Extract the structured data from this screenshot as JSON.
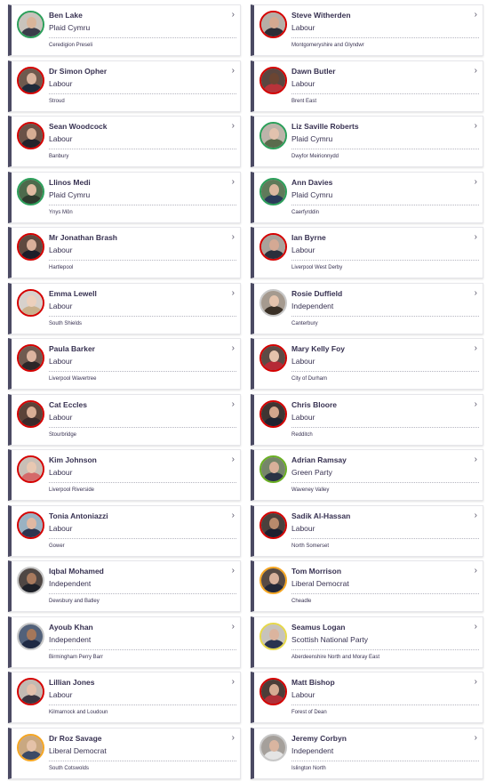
{
  "cards": [
    {
      "name": "Ben Lake",
      "party": "Plaid Cymru",
      "constituency": "Ceredigion Preseli",
      "party_color": "#2b9f5a",
      "skin": "#d9b59a",
      "attire": "#3a3d4a",
      "bg": "#c9c3bc"
    },
    {
      "name": "Steve Witherden",
      "party": "Labour",
      "constituency": "Montgomeryshire and Glyndwr",
      "party_color": "#d50000",
      "skin": "#d4a890",
      "attire": "#2d2d36",
      "bg": "#b7aea6"
    },
    {
      "name": "Dr Simon Opher",
      "party": "Labour",
      "constituency": "Stroud",
      "party_color": "#d50000",
      "skin": "#d8b49e",
      "attire": "#1f2a3a",
      "bg": "#6e5a4e"
    },
    {
      "name": "Dawn Butler",
      "party": "Labour",
      "constituency": "Brent East",
      "party_color": "#d50000",
      "skin": "#6b4532",
      "attire": "#b8333a",
      "bg": "#5a4640"
    },
    {
      "name": "Sean Woodcock",
      "party": "Labour",
      "constituency": "Banbury",
      "party_color": "#d50000",
      "skin": "#d6ad94",
      "attire": "#23242c",
      "bg": "#6a5247"
    },
    {
      "name": "Liz Saville Roberts",
      "party": "Plaid Cymru",
      "constituency": "Dwyfor Meirionnydd",
      "party_color": "#2b9f5a",
      "skin": "#e2c2ae",
      "attire": "#5a6b4c",
      "bg": "#bdb4aa"
    },
    {
      "name": "Llinos Medi",
      "party": "Plaid Cymru",
      "constituency": "Ynys Môn",
      "party_color": "#2b9f5a",
      "skin": "#e0bba2",
      "attire": "#2e3b2e",
      "bg": "#4d6a4c"
    },
    {
      "name": "Ann Davies",
      "party": "Plaid Cymru",
      "constituency": "Caerfyrddin",
      "party_color": "#2b9f5a",
      "skin": "#dcb89f",
      "attire": "#2a3a58",
      "bg": "#5f7a5a"
    },
    {
      "name": "Mr Jonathan Brash",
      "party": "Labour",
      "constituency": "Hartlepool",
      "party_color": "#d50000",
      "skin": "#d9b09a",
      "attire": "#1c1e2a",
      "bg": "#5e4a40"
    },
    {
      "name": "Ian Byrne",
      "party": "Labour",
      "constituency": "Liverpool West Derby",
      "party_color": "#d50000",
      "skin": "#d4a994",
      "attire": "#2a2f3c",
      "bg": "#a9a29b"
    },
    {
      "name": "Emma Lewell",
      "party": "Labour",
      "constituency": "South Shields",
      "party_color": "#d50000",
      "skin": "#ecd0bd",
      "attire": "#c9b08c",
      "bg": "#d7d1cc"
    },
    {
      "name": "Rosie Duffield",
      "party": "Independent",
      "constituency": "Canterbury",
      "party_color": "#c8c8c8",
      "skin": "#e5c4ad",
      "attire": "#3a3026",
      "bg": "#a59a8f"
    },
    {
      "name": "Paula Barker",
      "party": "Labour",
      "constituency": "Liverpool Wavertree",
      "party_color": "#d50000",
      "skin": "#dcb4a0",
      "attire": "#2b2628",
      "bg": "#6f5a50"
    },
    {
      "name": "Mary Kelly Foy",
      "party": "Labour",
      "constituency": "City of Durham",
      "party_color": "#d50000",
      "skin": "#e6c2ac",
      "attire": "#b52a36",
      "bg": "#5c4b45"
    },
    {
      "name": "Cat Eccles",
      "party": "Labour",
      "constituency": "Stourbridge",
      "party_color": "#d50000",
      "skin": "#d8ad95",
      "attire": "#3a2a2a",
      "bg": "#5b4339"
    },
    {
      "name": "Chris Bloore",
      "party": "Labour",
      "constituency": "Redditch",
      "party_color": "#d50000",
      "skin": "#d3a68c",
      "attire": "#1f2330",
      "bg": "#3f3532"
    },
    {
      "name": "Kim Johnson",
      "party": "Labour",
      "constituency": "Liverpool Riverside",
      "party_color": "#d50000",
      "skin": "#e8c8b2",
      "attire": "#d46a6a",
      "bg": "#c9bfb6"
    },
    {
      "name": "Adrian Ramsay",
      "party": "Green Party",
      "constituency": "Waveney Valley",
      "party_color": "#6ab023",
      "skin": "#d8b09a",
      "attire": "#2a3345",
      "bg": "#75856a"
    },
    {
      "name": "Tonia Antoniazzi",
      "party": "Labour",
      "constituency": "Gower",
      "party_color": "#d50000",
      "skin": "#e0b8a2",
      "attire": "#2d3550",
      "bg": "#9ab2c2"
    },
    {
      "name": "Sadik Al-Hassan",
      "party": "Labour",
      "constituency": "North Somerset",
      "party_color": "#d50000",
      "skin": "#b88a6c",
      "attire": "#1c2030",
      "bg": "#4a403c"
    },
    {
      "name": "Iqbal Mohamed",
      "party": "Independent",
      "constituency": "Dewsbury and Batley",
      "party_color": "#c8c8c8",
      "skin": "#a87a5e",
      "attire": "#1d2028",
      "bg": "#4f4744"
    },
    {
      "name": "Tom Morrison",
      "party": "Liberal Democrat",
      "constituency": "Cheadle",
      "party_color": "#f5a623",
      "skin": "#d9b29c",
      "attire": "#232838",
      "bg": "#574a44"
    },
    {
      "name": "Ayoub Khan",
      "party": "Independent",
      "constituency": "Birmingham Perry Barr",
      "party_color": "#c8c8c8",
      "skin": "#a5775a",
      "attire": "#1f2a44",
      "bg": "#52617a"
    },
    {
      "name": "Seamus Logan",
      "party": "Scottish National Party",
      "constituency": "Aberdeenshire North and Moray East",
      "party_color": "#e6d84a",
      "skin": "#dbb49e",
      "attire": "#2a3350",
      "bg": "#c7c3bc"
    },
    {
      "name": "Lillian Jones",
      "party": "Labour",
      "constituency": "Kilmarnock and Loudoun",
      "party_color": "#d50000",
      "skin": "#e2c0ab",
      "attire": "#3a3540",
      "bg": "#c2bab2"
    },
    {
      "name": "Matt Bishop",
      "party": "Labour",
      "constituency": "Forest of Dean",
      "party_color": "#d50000",
      "skin": "#d6ab93",
      "attire": "#b03038",
      "bg": "#4c3d38"
    },
    {
      "name": "Dr Roz Savage",
      "party": "Liberal Democrat",
      "constituency": "South Cotswolds",
      "party_color": "#f5a623",
      "skin": "#e5c2a8",
      "attire": "#3b4a66",
      "bg": "#c9a881"
    },
    {
      "name": "Jeremy Corbyn",
      "party": "Independent",
      "constituency": "Islington North",
      "party_color": "#c8c8c8",
      "skin": "#d9b5a0",
      "attire": "#e4e4e4",
      "bg": "#a5a09b"
    }
  ],
  "icons": {
    "chevron": "›"
  }
}
